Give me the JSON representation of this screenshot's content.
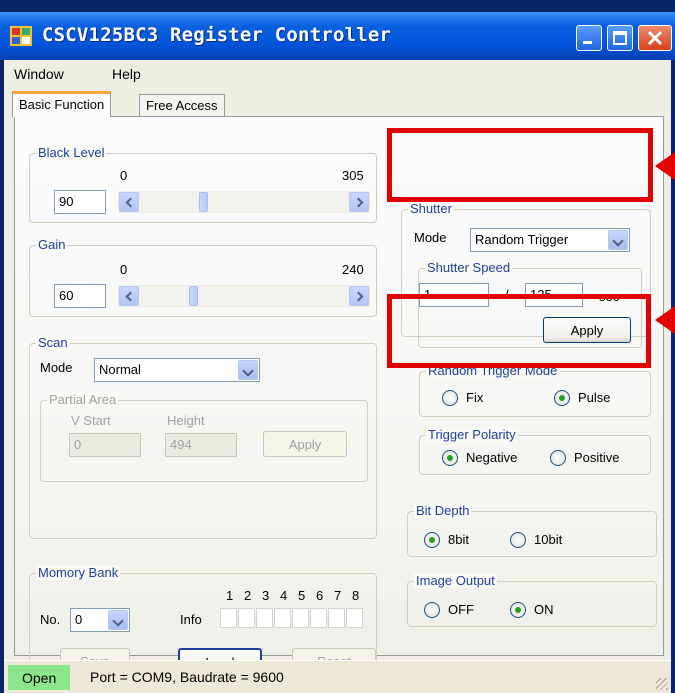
{
  "window": {
    "title": "CSCV125BC3 Register Controller"
  },
  "menu": {
    "items": [
      "Window",
      "Help"
    ]
  },
  "tabs": [
    {
      "label": "Basic Function"
    },
    {
      "label": "Free Access"
    }
  ],
  "black_level": {
    "label": "Black Level",
    "min": "0",
    "max": "305",
    "value": "90",
    "fraction": 0.3
  },
  "gain": {
    "label": "Gain",
    "min": "0",
    "max": "240",
    "value": "60",
    "fraction": 0.25
  },
  "scan": {
    "label": "Scan",
    "mode_label": "Mode",
    "mode_value": "Normal",
    "partial_area": {
      "label": "Partial Area",
      "v_start_label": "V Start",
      "height_label": "Height",
      "v_start_value": "0",
      "height_value": "494",
      "apply_label": "Apply"
    }
  },
  "memory_bank": {
    "label": "Momory Bank",
    "no_label": "No.",
    "no_value": "0",
    "info_label": "Info",
    "slot_numbers": [
      "1",
      "2",
      "3",
      "4",
      "5",
      "6",
      "7",
      "8"
    ],
    "save_label": "Save",
    "load_label": "Load",
    "reset_label": "Reset"
  },
  "shutter": {
    "label": "Shutter",
    "mode_label": "Mode",
    "mode_value": "Random Trigger"
  },
  "shutter_speed": {
    "label": "Shutter Speed",
    "numerator": "1",
    "separator": "/",
    "denominator": "125",
    "unit": "sec",
    "apply_label": "Apply"
  },
  "random_trigger_mode": {
    "label": "Random Trigger Mode",
    "options": [
      "Fix",
      "Pulse"
    ],
    "selected": "Pulse"
  },
  "trigger_polarity": {
    "label": "Trigger Polarity",
    "options": [
      "Negative",
      "Positive"
    ],
    "selected": "Negative"
  },
  "bit_depth": {
    "label": "Bit Depth",
    "options": [
      "8bit",
      "10bit"
    ],
    "selected": "8bit"
  },
  "image_output": {
    "label": "Image Output",
    "options": [
      "OFF",
      "ON"
    ],
    "selected": "ON"
  },
  "status": {
    "connection": "Open",
    "port_info": "Port = COM9,  Baudrate = 9600"
  },
  "colors": {
    "highlight": "#e30000",
    "status_open": "#8ce78c",
    "titlebar": "#0353d8",
    "group_label": "#1f3fa0"
  }
}
